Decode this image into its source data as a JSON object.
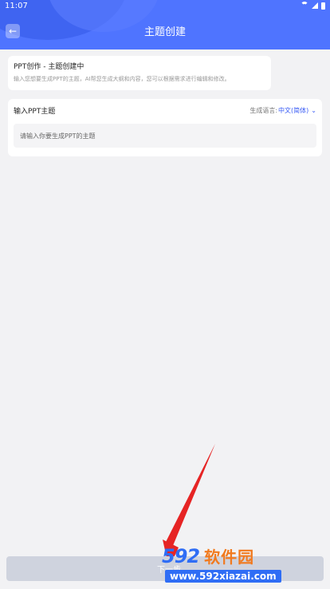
{
  "status_bar": {
    "time": "11:07"
  },
  "header": {
    "title": "主题创建"
  },
  "intro_card": {
    "title": "PPT创作 - 主题创建中",
    "description": "输入您想要生成PPT的主题，AI帮您生成大纲和内容，您可以根据需求进行编辑和修改。"
  },
  "topic_card": {
    "label": "输入PPT主题",
    "language_label": "生成语言:",
    "language_value": "中文(简体)",
    "input_placeholder": "请输入你要生成PPT的主题"
  },
  "footer": {
    "next_label": "下一步"
  },
  "watermark": {
    "numbers": "592",
    "text": "软件园",
    "url": "www.592xiazai.com"
  },
  "colors": {
    "primary": "#4f74ff",
    "accent": "#3a5cf5",
    "button_disabled": "#cfd3de",
    "annotation_arrow": "#e62424"
  }
}
